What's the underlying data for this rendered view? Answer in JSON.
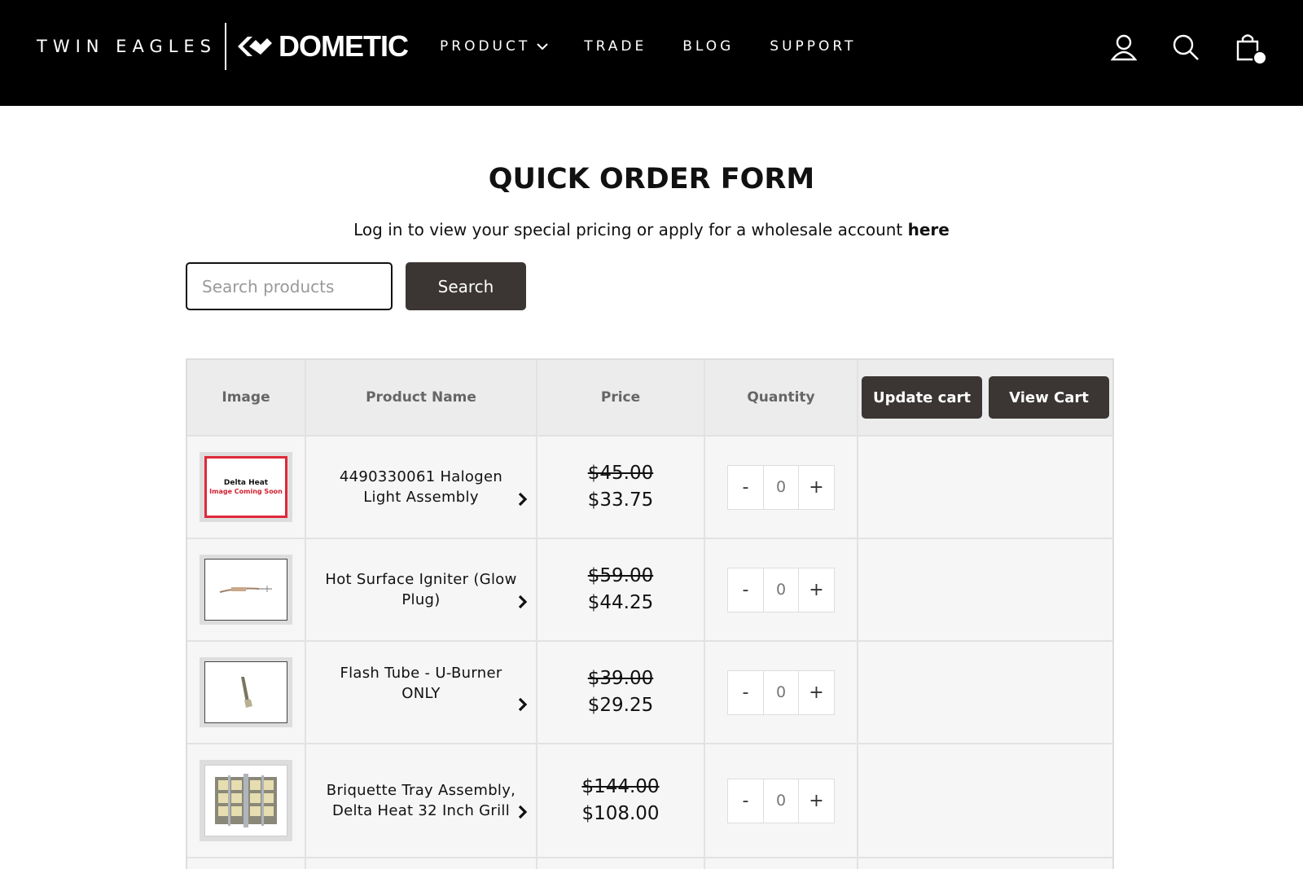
{
  "header": {
    "brand_primary": "TWIN EAGLES",
    "brand_secondary": "DOMETIC",
    "nav": [
      {
        "label": "PRODUCT",
        "has_dropdown": true
      },
      {
        "label": "TRADE"
      },
      {
        "label": "BLOG"
      },
      {
        "label": "SUPPORT"
      }
    ],
    "icons": [
      "account-icon",
      "search-icon",
      "cart-icon"
    ]
  },
  "main": {
    "title": "QUICK ORDER FORM",
    "subtitle_text": "Log in to view your special pricing or apply for a wholesale account",
    "subtitle_link": "here",
    "search": {
      "placeholder": "Search products",
      "button_label": "Search"
    }
  },
  "table": {
    "columns": [
      "Image",
      "Product Name",
      "Price",
      "Quantity"
    ],
    "update_cart_label": "Update cart",
    "view_cart_label": "View Cart",
    "rows": [
      {
        "image": "placeholder",
        "placeholder_title": "Delta Heat",
        "placeholder_note": "Image Coming Soon",
        "name": "4490330061 Halogen Light Assembly",
        "old_price": "$45.00",
        "price": "$33.75",
        "qty": "0",
        "minus": "-",
        "plus": "+"
      },
      {
        "image": "igniter",
        "name": "Hot Surface Igniter (Glow Plug)",
        "old_price": "$59.00",
        "price": "$44.25",
        "qty": "0",
        "minus": "-",
        "plus": "+"
      },
      {
        "image": "flash-tube",
        "name": "Flash Tube - U-Burner ONLY",
        "old_price": "$39.00",
        "price": "$29.25",
        "qty": "0",
        "minus": "-",
        "plus": "+"
      },
      {
        "image": "briquette-tray",
        "name": "Briquette Tray Assembly, Delta Heat 32 Inch Grill",
        "old_price": "$144.00",
        "price": "$108.00",
        "qty": "0",
        "minus": "-",
        "plus": "+"
      }
    ]
  },
  "colors": {
    "header_bg": "#000000",
    "button_bg": "#3b3634",
    "placeholder_red": "#e0283a"
  }
}
